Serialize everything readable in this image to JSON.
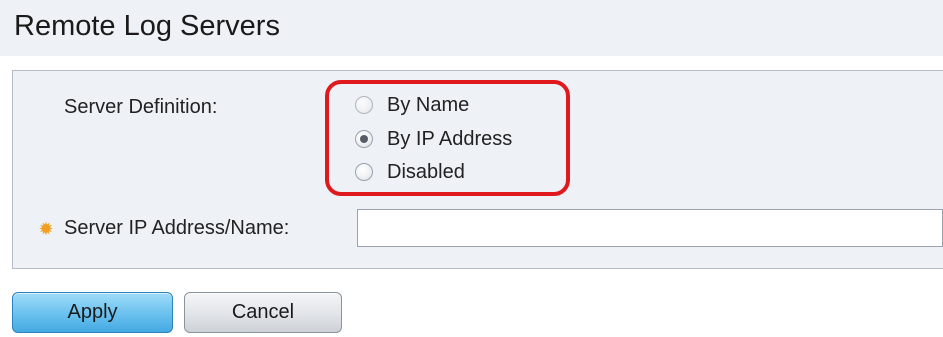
{
  "page": {
    "title": "Remote Log Servers"
  },
  "form": {
    "server_definition_label": "Server Definition:",
    "server_definition_options": [
      {
        "label": "By Name",
        "checked": false
      },
      {
        "label": "By IP Address",
        "checked": true
      },
      {
        "label": "Disabled",
        "checked": false
      }
    ],
    "server_address_label": "Server IP Address/Name:",
    "server_address_value": "",
    "required_icon": "required-gear-icon"
  },
  "buttons": {
    "apply_label": "Apply",
    "cancel_label": "Cancel"
  },
  "colors": {
    "highlight": "#e0191f",
    "required_icon": "#f0a020",
    "apply_button": "#6ec3ef",
    "panel_background": "#eef2f7"
  }
}
